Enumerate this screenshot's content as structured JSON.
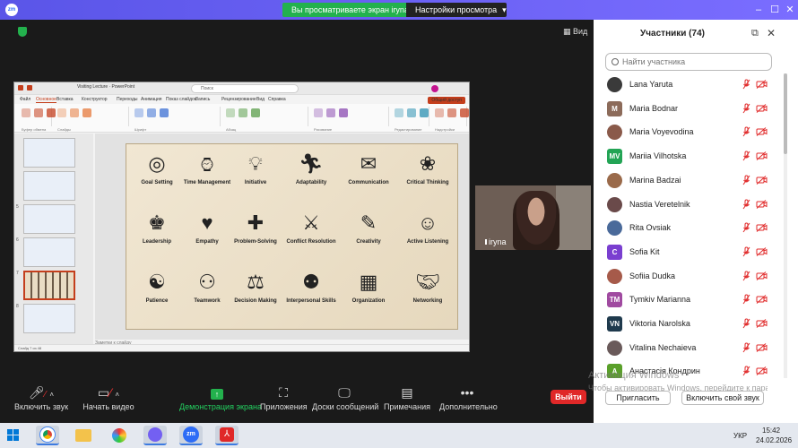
{
  "titlebar": {
    "banner": "Вы просматриваете экран iryna",
    "view_settings": "Настройки просмотра"
  },
  "meeting": {
    "view_label": "Вид",
    "video_tile_name": "iryna"
  },
  "ppt": {
    "title": "Visiting Lecture · PowerPoint",
    "search_placeholder": "Поиск",
    "menu": [
      "Файл",
      "Основное",
      "Вставка",
      "Конструктор",
      "Переходы",
      "Анимация",
      "Показ слайдов",
      "Запись",
      "Рецензирование",
      "Вид",
      "Справка"
    ],
    "active_menu": "Основное",
    "share_label": "Общий доступ",
    "ribbon_groups": [
      "Буфер обмена",
      "Слайды",
      "Шрифт",
      "Абзац",
      "Рисование",
      "Редактирование",
      "Надстройки"
    ],
    "notes_placeholder": "Заметки к слайду",
    "status_left": "Слайд 7 из 48",
    "thumb_numbers": [
      "5",
      "6",
      "7",
      "8"
    ],
    "skills": [
      {
        "label": "Goal Setting",
        "icon": "target-icon"
      },
      {
        "label": "Time Management",
        "icon": "watch-icon"
      },
      {
        "label": "Initiative",
        "icon": "lightbulb-icon"
      },
      {
        "label": "Adaptability",
        "icon": "person-icon"
      },
      {
        "label": "Communication",
        "icon": "envelope-icon"
      },
      {
        "label": "Critical Thinking",
        "icon": "brain-icon"
      },
      {
        "label": "Leadership",
        "icon": "leader-icon"
      },
      {
        "label": "Empathy",
        "icon": "hug-icon"
      },
      {
        "label": "Problem-Solving",
        "icon": "puzzle-icon"
      },
      {
        "label": "Conflict Resolution",
        "icon": "conflict-icon"
      },
      {
        "label": "Creativity",
        "icon": "pencils-icon"
      },
      {
        "label": "Active Listening",
        "icon": "listening-icon"
      },
      {
        "label": "Patience",
        "icon": "meditation-icon"
      },
      {
        "label": "Teamwork",
        "icon": "team-icon"
      },
      {
        "label": "Decision Making",
        "icon": "decision-icon"
      },
      {
        "label": "Interpersonal Skills",
        "icon": "people-icon"
      },
      {
        "label": "Organization",
        "icon": "calendar-icon"
      },
      {
        "label": "Networking",
        "icon": "handshake-icon"
      }
    ]
  },
  "toolbar": {
    "mute": "Включить звук",
    "video": "Начать видео",
    "share": "Демонстрация экрана",
    "apps": "Приложения",
    "whiteboards": "Доски сообщений",
    "notes": "Примечания",
    "more": "Дополнительно",
    "leave": "Выйти"
  },
  "panel": {
    "title": "Участники (74)",
    "search_placeholder": "Найти участника",
    "participants": [
      {
        "name": "Lana Yaruta",
        "initials": "",
        "color": "#3a3a3a"
      },
      {
        "name": "Maria Bodnar",
        "initials": "M",
        "color": "#8c6b5a"
      },
      {
        "name": "Maria Voyevodina",
        "initials": "",
        "color": "#8a5a4a"
      },
      {
        "name": "Mariia Vilhotska",
        "initials": "MV",
        "color": "#23a455"
      },
      {
        "name": "Marina Badzai",
        "initials": "",
        "color": "#9a6a4a"
      },
      {
        "name": "Nastia Veretelnik",
        "initials": "",
        "color": "#6a4a4a"
      },
      {
        "name": "Rita Ovsiak",
        "initials": "",
        "color": "#4a6a9a"
      },
      {
        "name": "Sofia Kit",
        "initials": "C",
        "color": "#7a3fd0"
      },
      {
        "name": "Sofiia Dudka",
        "initials": "",
        "color": "#a65a4a"
      },
      {
        "name": "Tymkiv Marianna",
        "initials": "TM",
        "color": "#a04aa0"
      },
      {
        "name": "Viktoria Narolska",
        "initials": "VN",
        "color": "#1f3a4d"
      },
      {
        "name": "Vitalina Nechaieva",
        "initials": "",
        "color": "#6a5a5a"
      },
      {
        "name": "Анастасія Кондрин",
        "initials": "A",
        "color": "#5aa02a"
      }
    ],
    "watermark_title": "Активация Windows",
    "watermark_sub": "Чтобы активировать Windows, перейдите к параметрам компьютера.",
    "invite": "Пригласить",
    "unmute_self": "Включить свой звук"
  },
  "taskbar": {
    "lang": "УКР",
    "time": "15:42",
    "date": "24.02.2026"
  }
}
